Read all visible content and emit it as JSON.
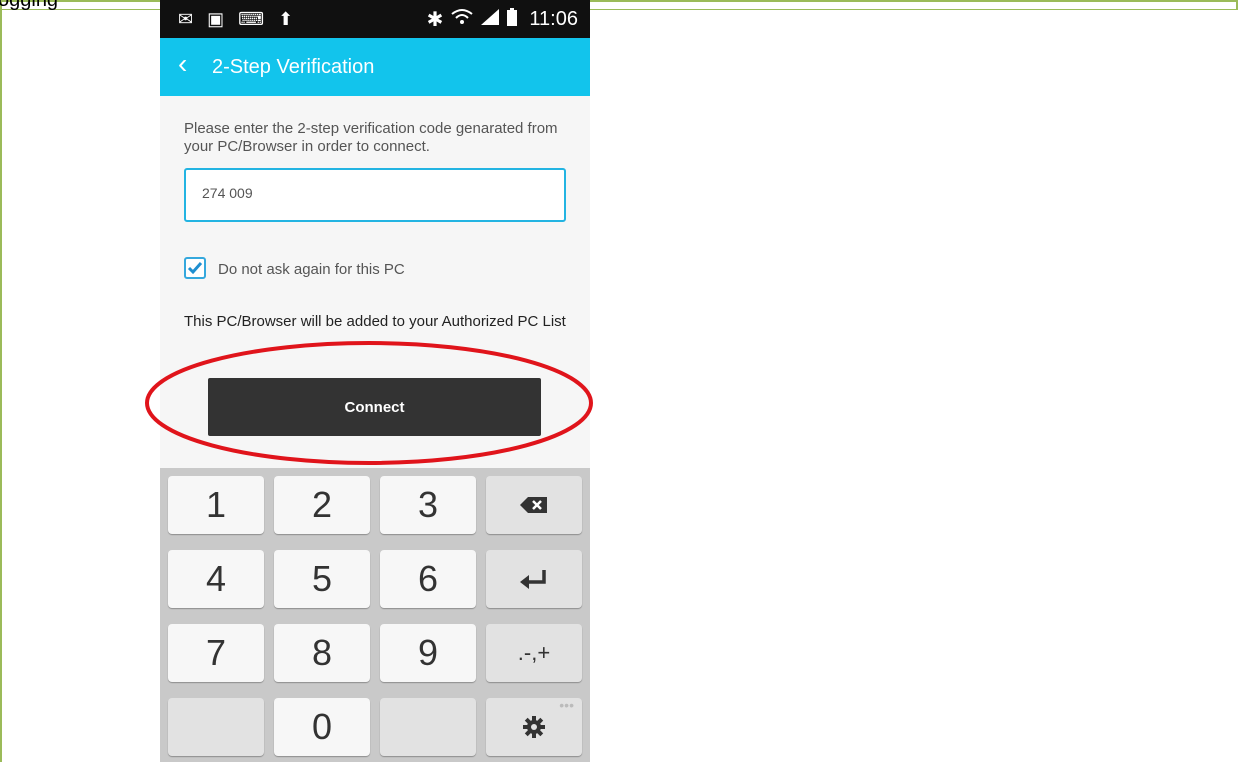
{
  "caption": "ogging",
  "status_bar": {
    "time": "11:06",
    "left_icons": [
      "mail-icon",
      "image-icon",
      "keyboard-icon",
      "upload-icon"
    ],
    "right_icons": [
      "bluetooth-icon",
      "wifi-icon",
      "signal-icon",
      "battery-icon"
    ]
  },
  "app_bar": {
    "title": "2-Step Verification",
    "back_icon": "back-chevron-icon"
  },
  "instructions": "Please enter the 2-step verification code genarated from your PC/Browser in order to connect.",
  "code_input": {
    "value": "274 009"
  },
  "checkbox": {
    "label": "Do not ask again for this PC",
    "checked": true
  },
  "authorized_note": "This PC/Browser will be added to your Authorized PC List",
  "connect_label": "Connect",
  "keyboard": {
    "keys": [
      "1",
      "2",
      "3",
      "4",
      "5",
      "6",
      "7",
      "8",
      "9",
      "0"
    ],
    "symbols_key": ".-,+",
    "special_icons": [
      "backspace-icon",
      "enter-icon",
      "settings-gear-icon"
    ]
  },
  "colors": {
    "appbar": "#12c4ec",
    "accent": "#23b4e2",
    "button": "#333333",
    "annotation": "#e0141b"
  }
}
